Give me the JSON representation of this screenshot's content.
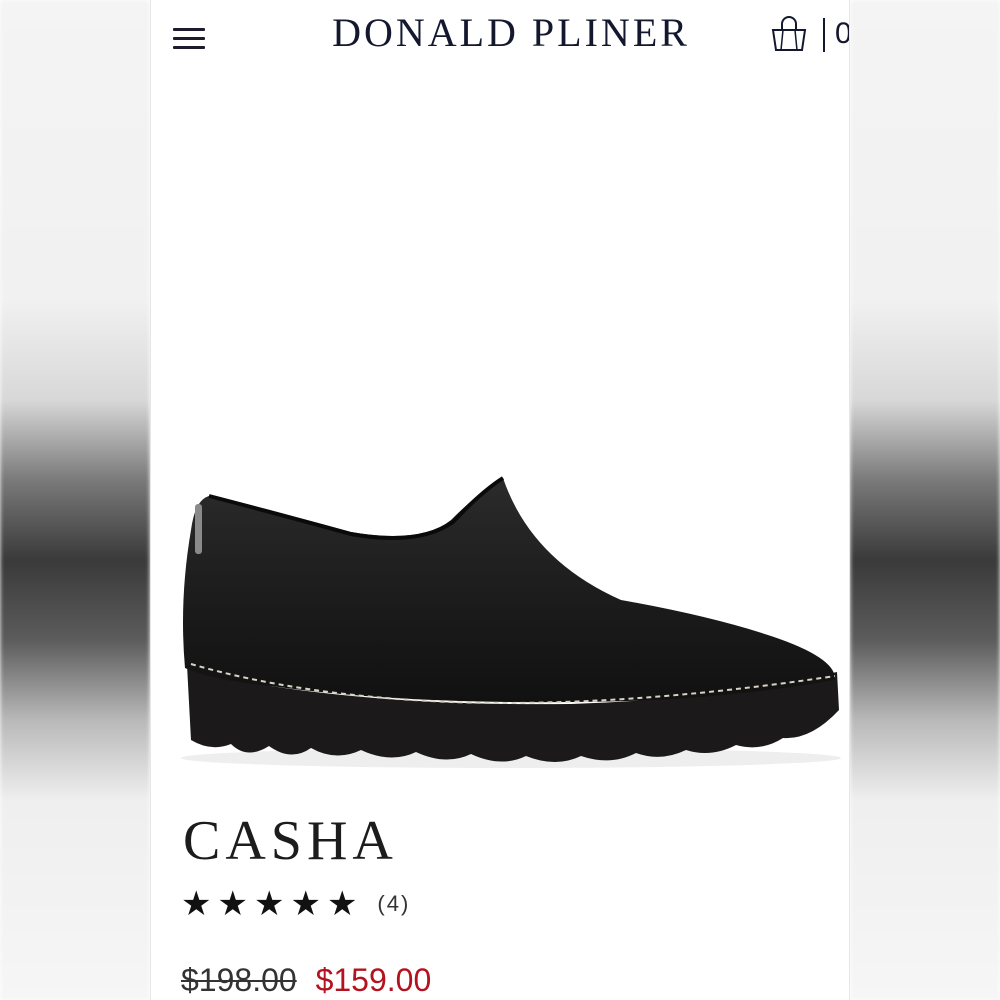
{
  "header": {
    "brand": "DONALD PLINER",
    "menu_icon": "hamburger-menu-icon",
    "bag_icon": "shopping-bag-icon",
    "cart_count": "0"
  },
  "product": {
    "image_icon": "black-slip-on-shoe-image",
    "name": "CASHA",
    "rating": 5,
    "rating_max": 5,
    "review_count": "(4)",
    "original_price": "$198.00",
    "sale_price": "$159.00"
  },
  "colors": {
    "brand_navy": "#13182e",
    "sale_red": "#b3121f"
  }
}
